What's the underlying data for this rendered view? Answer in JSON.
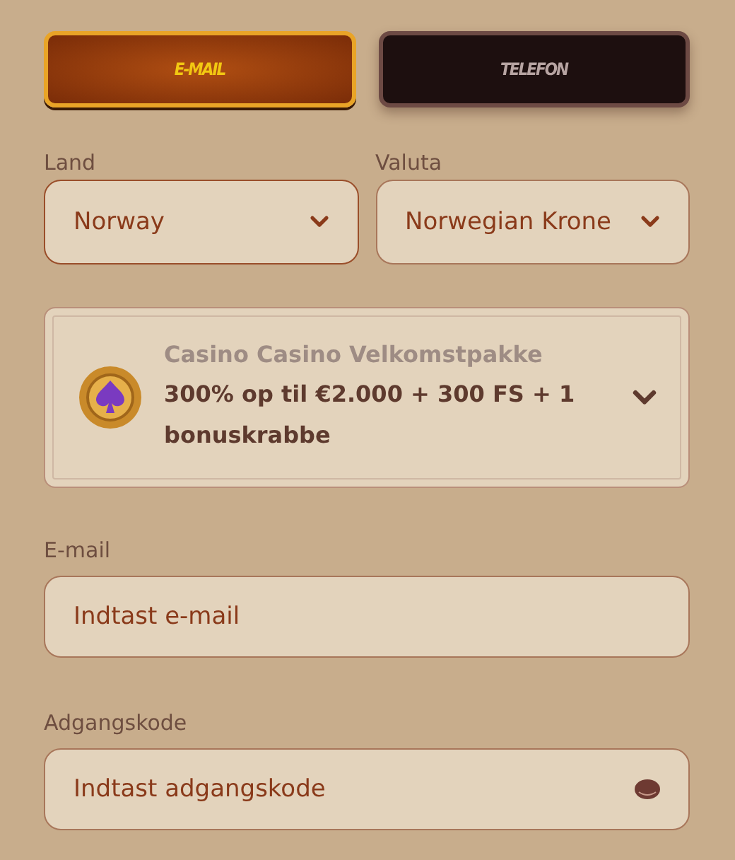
{
  "tabs": [
    {
      "label": "E-MAIL",
      "selected": true
    },
    {
      "label": "TELEFON",
      "selected": false
    }
  ],
  "selects": [
    {
      "label": "Land",
      "value": "Norway"
    },
    {
      "label": "Valuta",
      "value": "Norwegian Krone"
    }
  ],
  "bonus": {
    "title": "Casino Casino Velkomstpakke",
    "description": "300% op til €2.000 + 300 FS + 1 bonuskrabbe"
  },
  "fields": [
    {
      "label": "E-mail",
      "placeholder": "Indtast e-mail",
      "kind": "text"
    },
    {
      "label": "Adgangskode",
      "placeholder": "Indtast adgangskode",
      "kind": "password"
    }
  ]
}
